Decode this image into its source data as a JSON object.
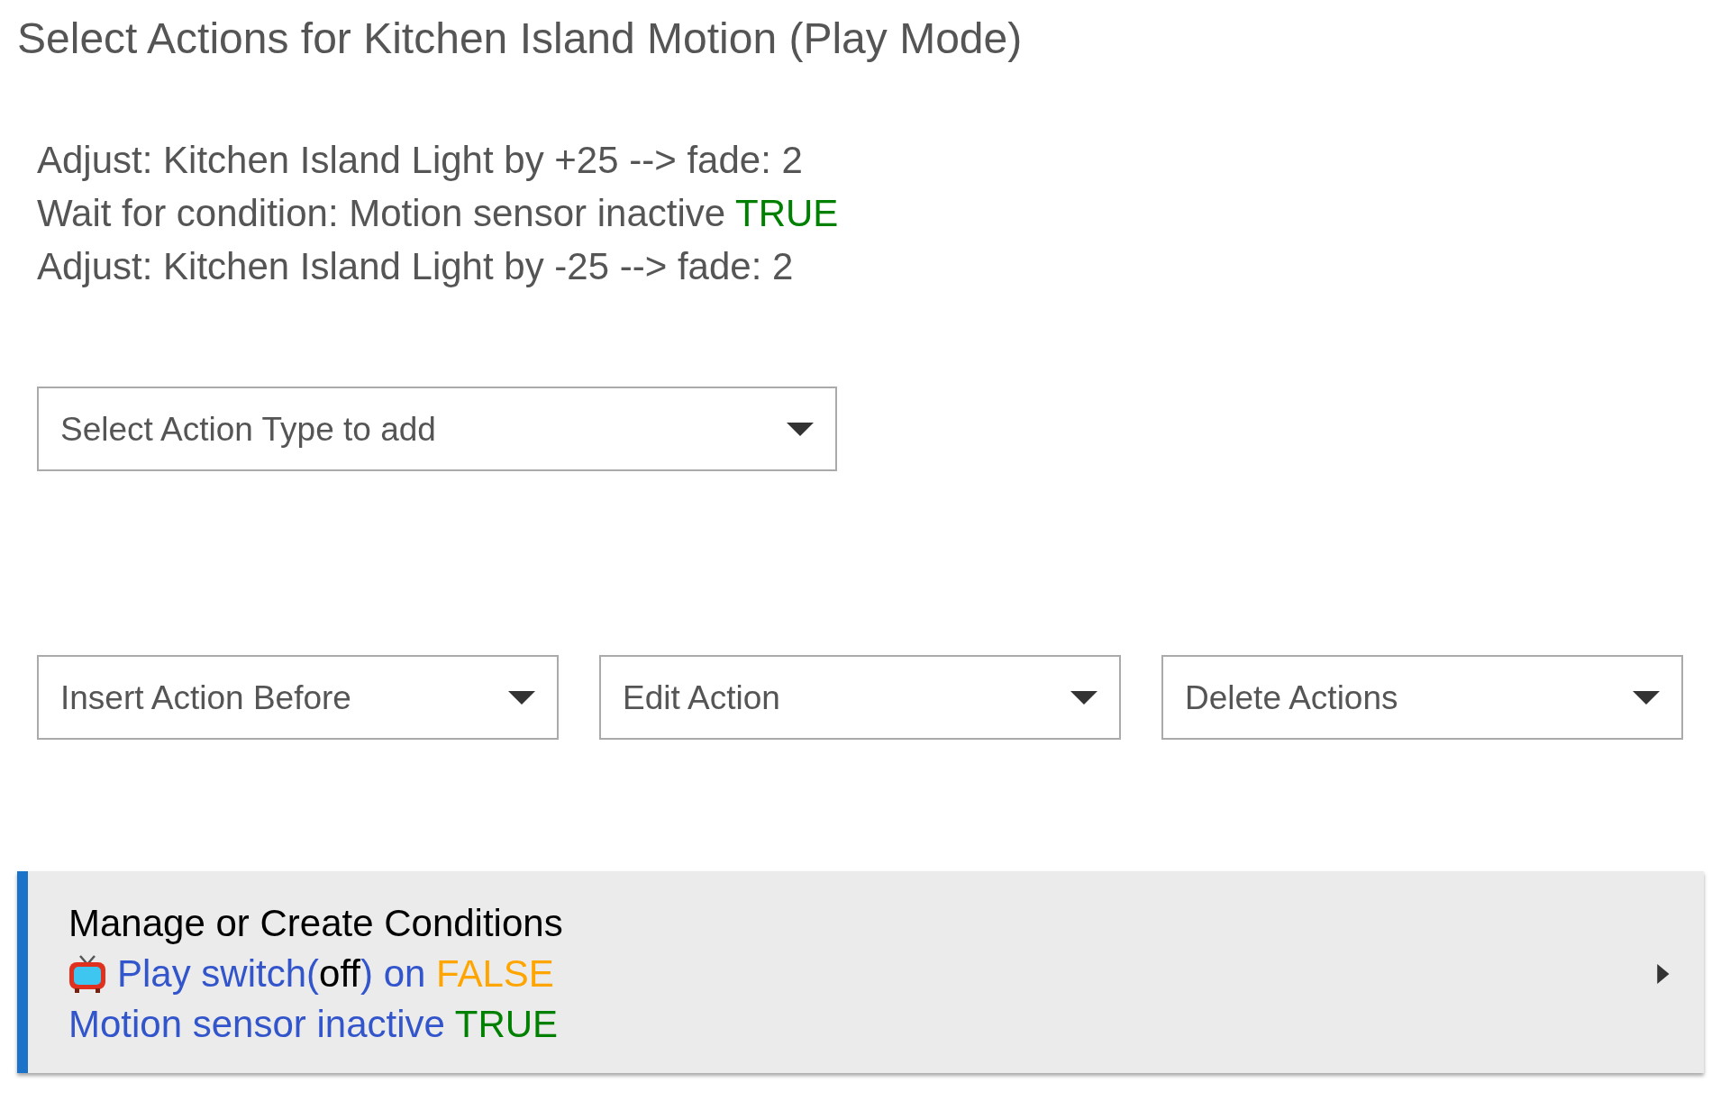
{
  "title": "Select Actions for Kitchen Island Motion (Play Mode)",
  "actions": [
    [
      {
        "text": "Adjust: Kitchen Island Light by +25 --> fade: 2",
        "color": "#555555"
      }
    ],
    [
      {
        "text": "Wait for condition: Motion sensor inactive ",
        "color": "#555555"
      },
      {
        "text": "TRUE",
        "color": "#008000"
      }
    ],
    [
      {
        "text": "Adjust: Kitchen Island Light by -25 --> fade: 2",
        "color": "#555555"
      }
    ]
  ],
  "add_action": {
    "placeholder": "Select Action Type to add"
  },
  "action_menus": [
    {
      "placeholder": "Insert Action Before"
    },
    {
      "placeholder": "Edit Action"
    },
    {
      "placeholder": "Delete Actions"
    }
  ],
  "conditions_panel": {
    "title": "Manage or Create Conditions",
    "expanded": false,
    "lines": [
      {
        "icon": true,
        "segments": [
          {
            "text": "Play switch(",
            "color": "#3355cc"
          },
          {
            "text": "off",
            "color": "#000000"
          },
          {
            "text": ") on ",
            "color": "#3355cc"
          },
          {
            "text": "FALSE",
            "color": "#ffa500"
          }
        ]
      },
      {
        "icon": false,
        "segments": [
          {
            "text": "Motion sensor inactive ",
            "color": "#3355cc"
          },
          {
            "text": "TRUE",
            "color": "#008000"
          }
        ]
      }
    ]
  }
}
